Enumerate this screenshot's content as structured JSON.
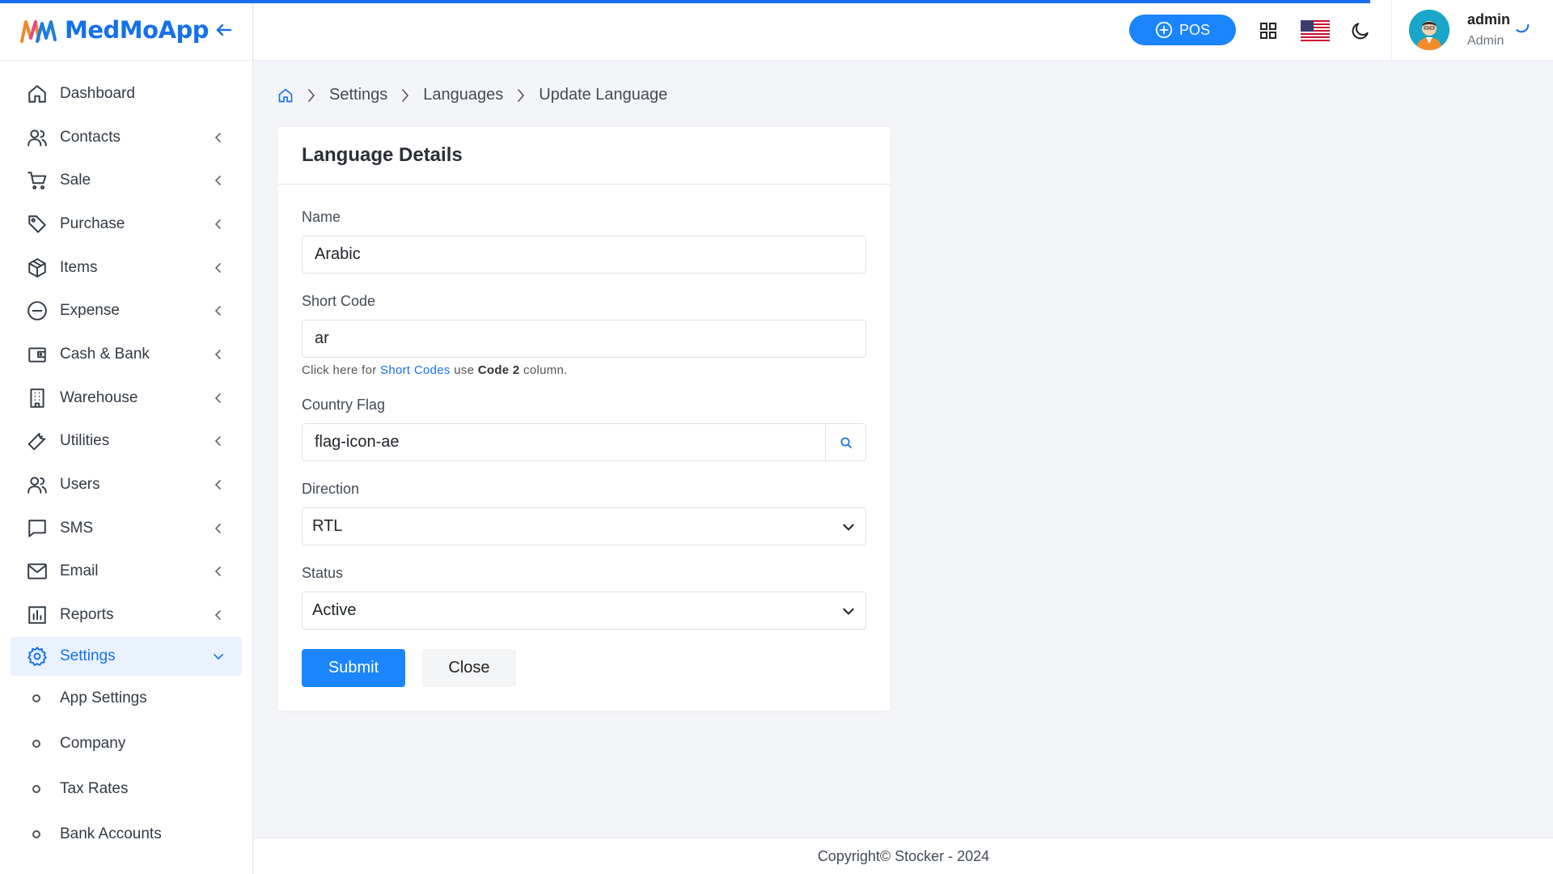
{
  "app": {
    "name": "MedMoApp",
    "logo_icon": "mm-logo-icon",
    "accent_color": "#1571e8",
    "primary_button_color": "#1a85ff"
  },
  "sidebar": {
    "collapse_icon": "arrow-left-icon",
    "items": [
      {
        "label": "Dashboard",
        "icon": "home-icon",
        "has_children": false
      },
      {
        "label": "Contacts",
        "icon": "users-icon",
        "has_children": true
      },
      {
        "label": "Sale",
        "icon": "cart-icon",
        "has_children": true
      },
      {
        "label": "Purchase",
        "icon": "tag-icon",
        "has_children": true
      },
      {
        "label": "Items",
        "icon": "box-icon",
        "has_children": true
      },
      {
        "label": "Expense",
        "icon": "minus-circle-icon",
        "has_children": true
      },
      {
        "label": "Cash & Bank",
        "icon": "wallet-icon",
        "has_children": true
      },
      {
        "label": "Warehouse",
        "icon": "building-icon",
        "has_children": true
      },
      {
        "label": "Utilities",
        "icon": "wrench-icon",
        "has_children": true
      },
      {
        "label": "Users",
        "icon": "users-icon",
        "has_children": true
      },
      {
        "label": "SMS",
        "icon": "message-icon",
        "has_children": true
      },
      {
        "label": "Email",
        "icon": "mail-icon",
        "has_children": true
      },
      {
        "label": "Reports",
        "icon": "bar-chart-icon",
        "has_children": true
      },
      {
        "label": "Settings",
        "icon": "gear-icon",
        "has_children": true,
        "active": true
      }
    ],
    "sub_items": [
      {
        "label": "App Settings"
      },
      {
        "label": "Company"
      },
      {
        "label": "Tax Rates"
      },
      {
        "label": "Bank Accounts"
      }
    ]
  },
  "topbar": {
    "pos_label": "POS",
    "apps_icon": "grid-icon",
    "language_flag_icon": "us-flag-icon",
    "theme_icon": "moon-icon",
    "user": {
      "name": "admin",
      "role": "Admin",
      "avatar_icon": "user-avatar-icon"
    }
  },
  "breadcrumb": {
    "home_icon": "home-icon",
    "items": [
      "Settings",
      "Languages",
      "Update Language"
    ]
  },
  "form": {
    "title": "Language Details",
    "name": {
      "label": "Name",
      "value": "Arabic"
    },
    "short_code": {
      "label": "Short Code",
      "value": "ar",
      "help_prefix": "Click here for",
      "help_link": "Short Codes",
      "help_middle": "use",
      "help_bold": "Code 2",
      "help_suffix": "column."
    },
    "country_flag": {
      "label": "Country Flag",
      "value": "flag-icon-ae",
      "search_icon": "search-icon"
    },
    "direction": {
      "label": "Direction",
      "value": "RTL"
    },
    "status": {
      "label": "Status",
      "value": "Active"
    },
    "submit_label": "Submit",
    "close_label": "Close"
  },
  "footer": {
    "text": "Copyright© Stocker - 2024"
  }
}
